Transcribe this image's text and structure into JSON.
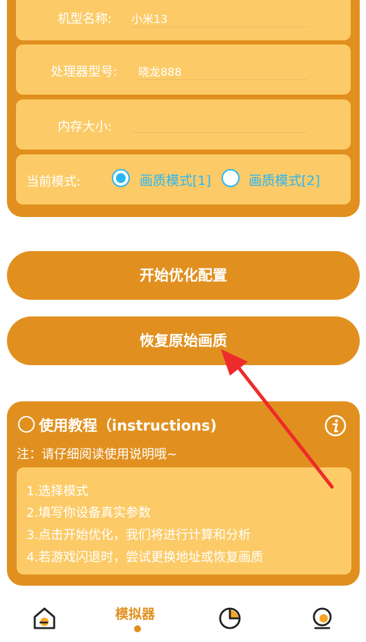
{
  "form": {
    "model_label": "机型名称:",
    "model_value": "小米13",
    "cpu_label": "处理器型号:",
    "cpu_value": "晓龙888",
    "memory_label": "内存大小:",
    "memory_value": "",
    "mode_label": "当前模式:",
    "mode1": "画质模式[1]",
    "mode2": "画质模式[2]"
  },
  "buttons": {
    "optimize": "开始优化配置",
    "restore": "恢复原始画质"
  },
  "tutorial": {
    "title": "使用教程（instructions)",
    "note": "注：请仔细阅读使用说明哦~",
    "steps": [
      "1.选择模式",
      "2.填写你设备真实参数",
      "3.点击开始优化，我们将进行计算和分析",
      "4.若游戏闪退时，尝试更换地址或恢复画质"
    ]
  },
  "nav": {
    "simulator": "模拟器"
  },
  "colors": {
    "accent": "#e1901f",
    "card_light": "#fccb67",
    "radio": "#29b6f6",
    "arrow": "#ee2b2b"
  }
}
